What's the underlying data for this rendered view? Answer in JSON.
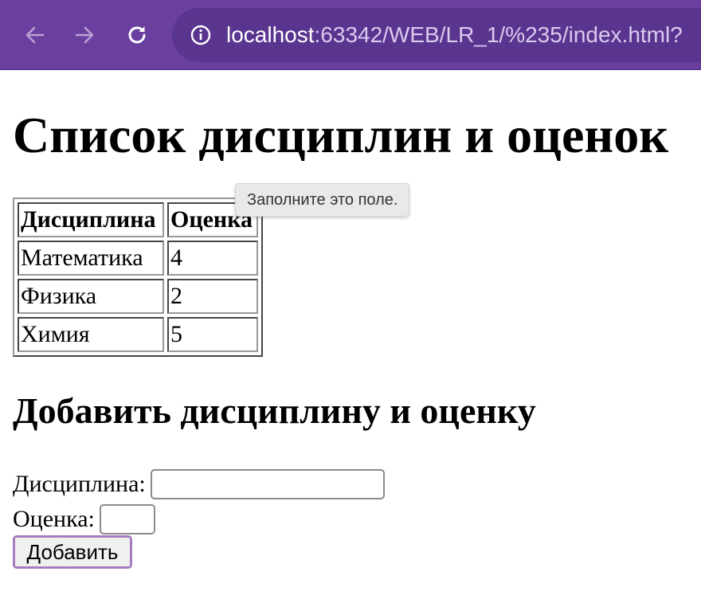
{
  "browser": {
    "url_host": "localhost",
    "url_rest": ":63342/WEB/LR_1/%235/index.html?",
    "accent_color": "#6a3fa0"
  },
  "page": {
    "title": "Список дисциплин и оценок",
    "table": {
      "headers": [
        "Дисциплина",
        "Оценка"
      ],
      "rows": [
        [
          "Математика",
          "4"
        ],
        [
          "Физика",
          "2"
        ],
        [
          "Химия",
          "5"
        ]
      ]
    },
    "form": {
      "heading": "Добавить дисциплину и оценку",
      "discipline_label": "Дисциплина:",
      "discipline_value": "",
      "grade_label": "Оценка:",
      "grade_value": "",
      "submit_label": "Добавить"
    },
    "tooltip": "Заполните это поле."
  },
  "icons": [
    "back-arrow-icon",
    "forward-arrow-icon",
    "reload-icon",
    "info-icon"
  ]
}
